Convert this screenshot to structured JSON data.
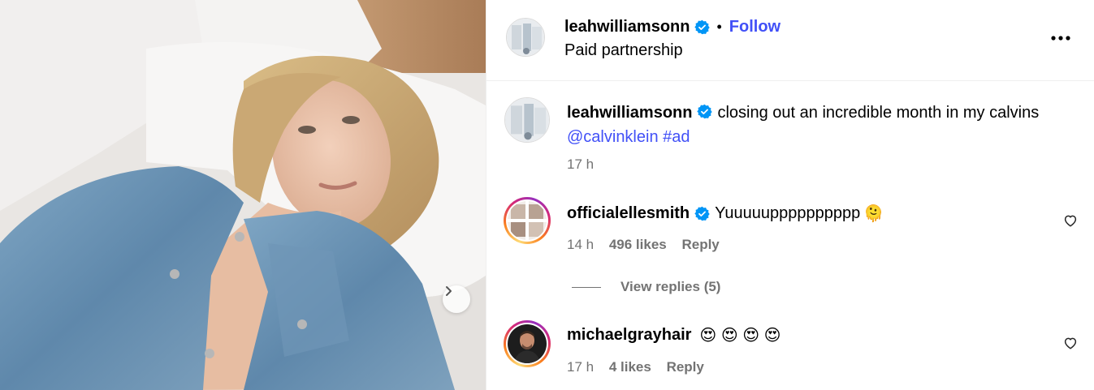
{
  "colors": {
    "link": "#4150f7",
    "muted": "#737373",
    "verified": "#0095f6",
    "divider": "#efefef"
  },
  "media": {
    "description_icon": "carousel-next-icon"
  },
  "header": {
    "username": "leahwilliamsonn",
    "separator": "•",
    "follow_label": "Follow",
    "subtitle": "Paid partnership",
    "more_icon": "more-horizontal-icon"
  },
  "caption": {
    "username": "leahwilliamsonn",
    "text": "closing out an incredible month in my calvins",
    "mention": "@calvinklein",
    "hashtag": "#ad",
    "time": "17 h"
  },
  "comments": [
    {
      "username": "officialellesmith",
      "text": "Yuuuuupppppppppp",
      "emoji": "🫠",
      "time": "14 h",
      "likes": "496 likes",
      "reply_label": "Reply",
      "view_replies": "View replies (5)"
    },
    {
      "username": "michaelgrayhair",
      "text": "",
      "emoji": "😍 😍 😍 😍",
      "time": "17 h",
      "likes": "4 likes",
      "reply_label": "Reply"
    }
  ]
}
